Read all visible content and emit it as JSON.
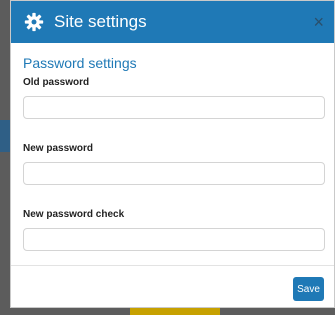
{
  "modal": {
    "title": "Site settings",
    "header_icon": "gear-icon",
    "close_icon": "close-icon",
    "close_glyph": "×",
    "accent_color": "#1f79b6"
  },
  "form": {
    "section_title": "Password settings",
    "fields": [
      {
        "label": "Old password",
        "value": "",
        "placeholder": ""
      },
      {
        "label": "New password",
        "value": "",
        "placeholder": ""
      },
      {
        "label": "New password check",
        "value": "",
        "placeholder": ""
      }
    ]
  },
  "footer": {
    "save_label": "Save"
  }
}
